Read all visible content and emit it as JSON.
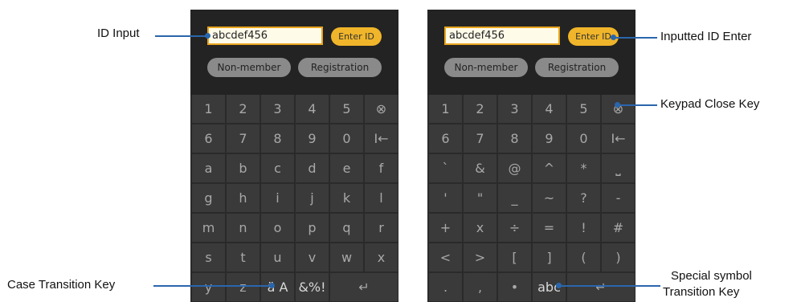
{
  "left_phone": {
    "id_value": "abcdef456",
    "enter_label": "Enter ID",
    "nonmember_label": "Non-member",
    "registration_label": "Registration",
    "keys": [
      "1",
      "2",
      "3",
      "4",
      "5",
      "⊗",
      "6",
      "7",
      "8",
      "9",
      "0",
      "I←",
      "a",
      "b",
      "c",
      "d",
      "e",
      "f",
      "g",
      "h",
      "i",
      "j",
      "k",
      "l",
      "m",
      "n",
      "o",
      "p",
      "q",
      "r",
      "s",
      "t",
      "u",
      "v",
      "w",
      "x",
      "y",
      "z",
      "ä A",
      "&%!",
      "↵"
    ]
  },
  "right_phone": {
    "id_value": "abcdef456",
    "enter_label": "Enter ID",
    "nonmember_label": "Non-member",
    "registration_label": "Registration",
    "keys": [
      "1",
      "2",
      "3",
      "4",
      "5",
      "⊗",
      "6",
      "7",
      "8",
      "9",
      "0",
      "I←",
      "`",
      "&",
      "@",
      "^",
      "*",
      "⎵",
      "'",
      "\"",
      "_",
      "~",
      "?",
      "-",
      "+",
      "x",
      "÷",
      "=",
      "!",
      "#",
      "<",
      ">",
      "[",
      "]",
      "(",
      ")",
      ".",
      ",",
      "•",
      "abc",
      "↵"
    ]
  },
  "callouts": {
    "id_input": "ID Input",
    "case_key": "Case Transition Key",
    "inputted_enter": "Inputted ID Enter",
    "keypad_close": "Keypad Close Key",
    "special_line1": "Special symbol",
    "special_line2": "Transition Key"
  },
  "colors": {
    "leader": "#2a66ad",
    "enter_button": "#f0b52a",
    "keypad_bg": "#2a2a2a"
  }
}
